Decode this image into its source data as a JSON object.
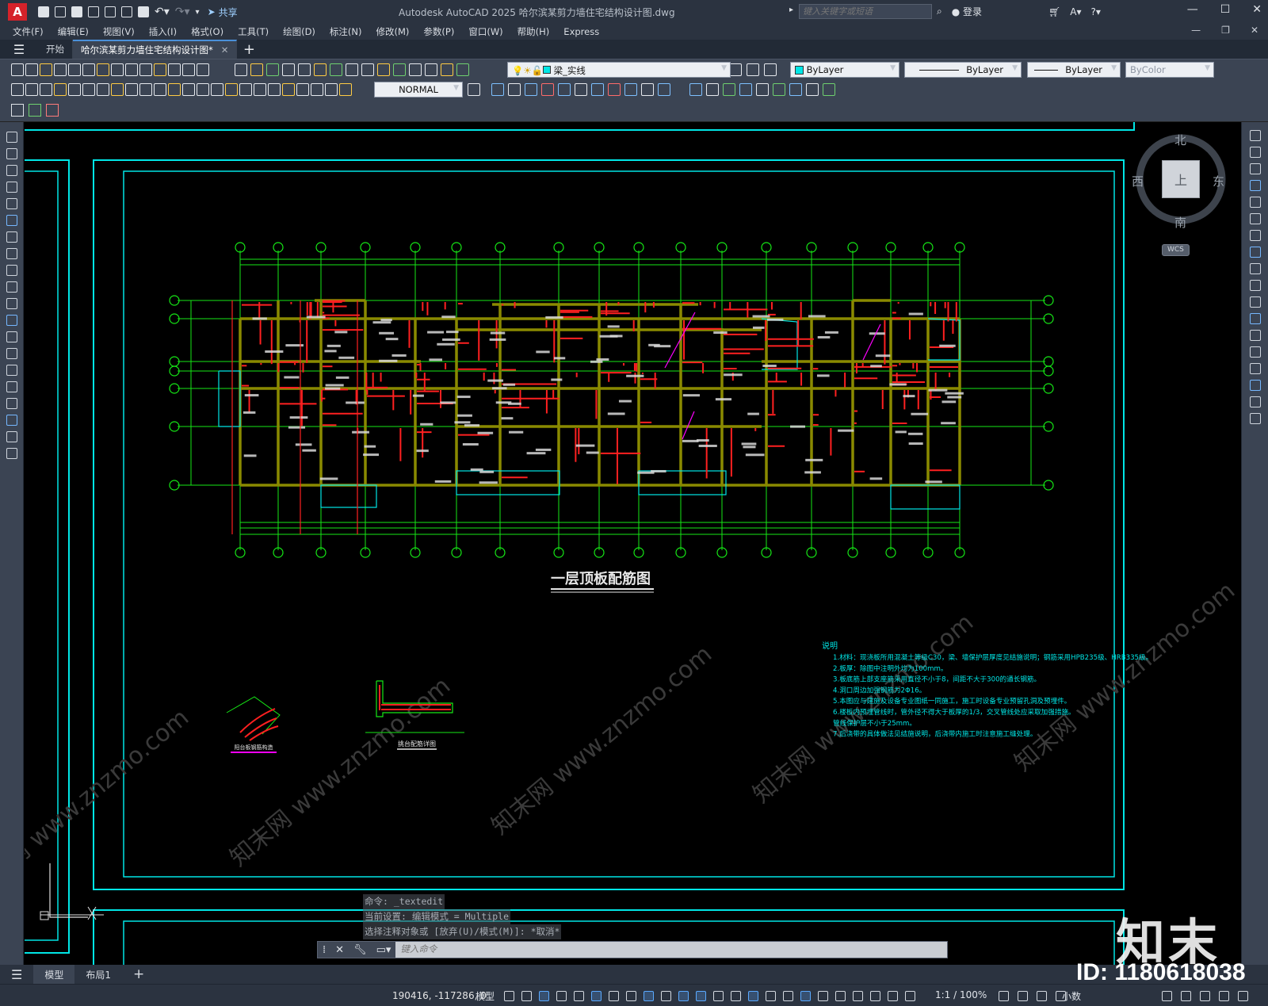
{
  "titlebar": {
    "app_logo": "A",
    "share_label": "共享",
    "title": "Autodesk AutoCAD 2025    哈尔滨某剪力墙住宅结构设计图.dwg",
    "search_placeholder": "键入关键字或短语",
    "login_label": "登录"
  },
  "menu": [
    "文件(F)",
    "编辑(E)",
    "视图(V)",
    "插入(I)",
    "格式(O)",
    "工具(T)",
    "绘图(D)",
    "标注(N)",
    "修改(M)",
    "参数(P)",
    "窗口(W)",
    "帮助(H)",
    "Express"
  ],
  "tabs": {
    "start": "开始",
    "doc": "哈尔滨某剪力墙住宅结构设计图*"
  },
  "toolbar": {
    "layer_name": "梁_实线",
    "color": "ByLayer",
    "linetype": "ByLayer",
    "lineweight": "ByLayer",
    "plotstyle": "ByColor",
    "dimstyle": "NORMAL"
  },
  "viewcube": {
    "north": "北",
    "south": "南",
    "east": "东",
    "west": "西",
    "top": "上",
    "wcs": "WCS"
  },
  "drawing": {
    "plan_title": "一层顶板配筋图",
    "detail1_title": "阳台板钢筋构造",
    "detail2_title": "挑台配筋详图",
    "notes_heading": "说明",
    "notes": [
      "1.材料：现浇板所用混凝土等级C30，梁、墙保护层厚度见结施说明；钢筋采用HPB235级、HRB335级。",
      "2.板厚：除图中注明外均为100mm。",
      "3.板底筋上部支座筋采用直径不小于8，间距不大于300的通长钢筋。",
      "4.洞口周边加强钢筋为2Φ16。",
      "5.本图应与建施及设备专业图纸一同施工，施工时设备专业预留孔洞及预埋件。",
      "6.楼板内预埋管线时，管外径不得大于板厚的1/3，交叉管线处应采取加强措施。",
      "  管线保护层不小于25mm。",
      "7.后浇带的具体做法见结施说明，后浇带内施工时注意施工缝处理。"
    ]
  },
  "command": {
    "history": [
      "命令:  _textedit",
      "当前设置: 编辑模式 = Multiple",
      "选择注释对象或 [放弃(U)/模式(M)]: *取消*"
    ],
    "placeholder": "键入命令"
  },
  "layout_tabs": {
    "model": "模型",
    "layout1": "布局1"
  },
  "status": {
    "coords": "190416, -117286, 0",
    "model": "模型",
    "scale": "1:1 / 100%",
    "units": "小数"
  },
  "watermark": {
    "brand": "知末",
    "id": "ID: 1180618038",
    "site": "知末网 www.znzmo.com"
  },
  "colors": {
    "cyan": "#00e6e6",
    "green": "#16e816",
    "red": "#ff2020",
    "yellow": "#c8c800",
    "magenta": "#ff00ff"
  }
}
